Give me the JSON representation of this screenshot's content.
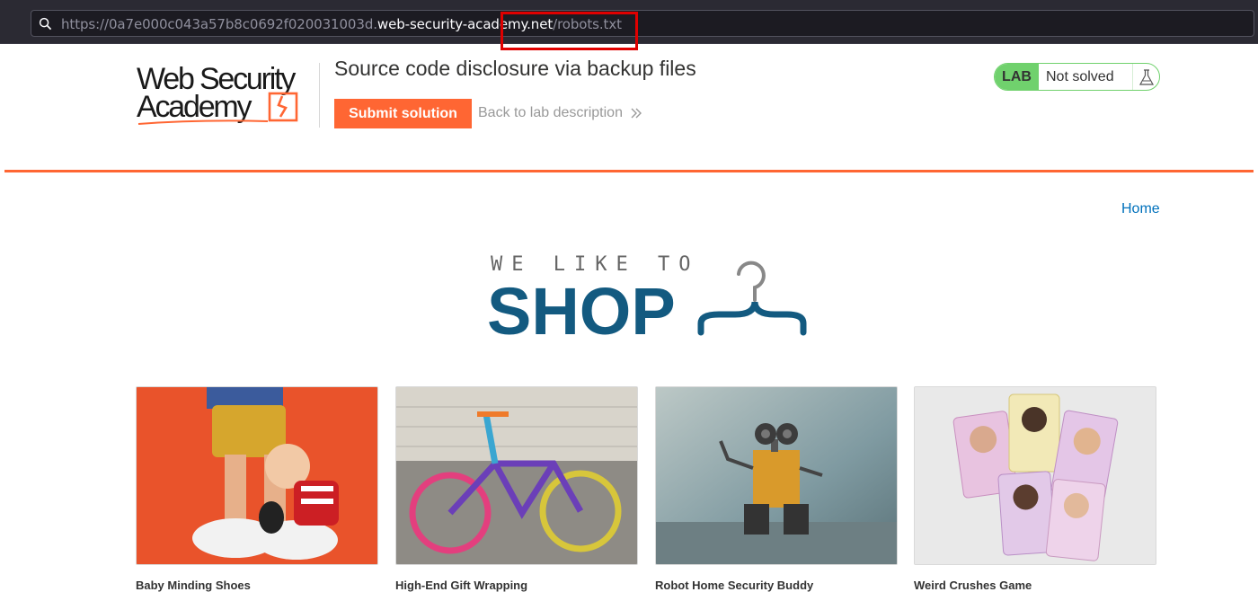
{
  "browser": {
    "url_prefix": "https://0a7e000c043a57b8c0692f020031003d.",
    "url_domain": "web-security-academy.net",
    "url_path": "/robots.txt"
  },
  "header": {
    "logo_line1": "Web Security",
    "logo_line2": "Academy",
    "lab_title": "Source code disclosure via backup files",
    "submit_label": "Submit solution",
    "back_label": "Back to lab description",
    "lab_badge": "LAB",
    "lab_state": "Not solved"
  },
  "nav": {
    "home_label": "Home"
  },
  "banner": {
    "tagline": "WE LIKE TO",
    "word": "SHOP"
  },
  "products": [
    {
      "name": "Baby Minding Shoes"
    },
    {
      "name": "High-End Gift Wrapping"
    },
    {
      "name": "Robot Home Security Buddy"
    },
    {
      "name": "Weird Crushes Game"
    }
  ],
  "colors": {
    "accent": "#ff6633",
    "lab_green": "#70d16d",
    "link_blue": "#0071bc",
    "shop_blue": "#135a80",
    "highlight_red": "#e00000"
  }
}
